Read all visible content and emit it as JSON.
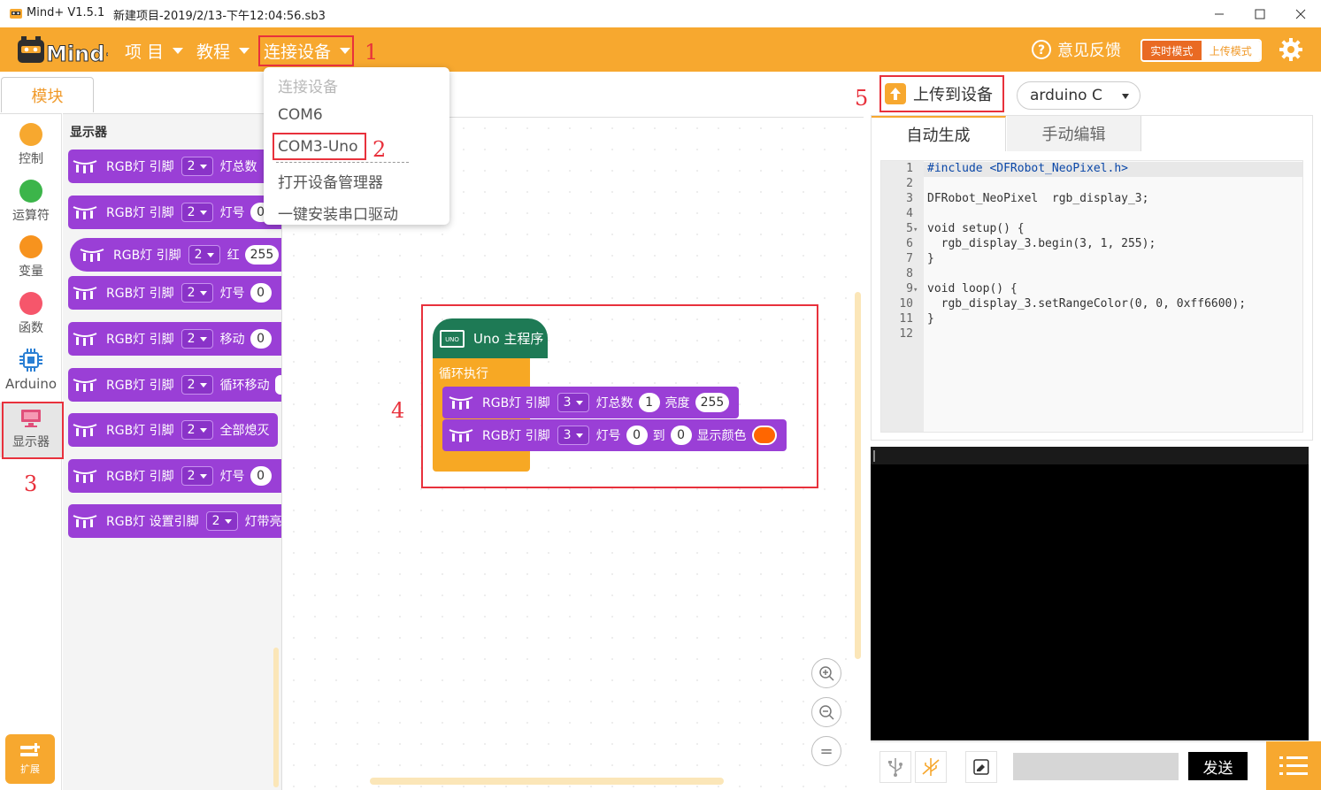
{
  "window": {
    "app_title": "Mind+ V1.5.1",
    "doc_title": "新建项目-2019/2/13-下午12:04:56.sb3"
  },
  "menubar": {
    "logo_text": "Mind+",
    "project": "项 目",
    "tutorial": "教程",
    "connect": "连接设备",
    "feedback": "意见反馈",
    "realtime_mode": "实时模式",
    "upload_mode": "上传模式"
  },
  "connect_menu": {
    "items": [
      {
        "label": "连接设备",
        "disabled": true
      },
      {
        "label": "COM6",
        "disabled": false
      },
      {
        "label": "COM3-Uno",
        "disabled": false
      },
      {
        "label": "打开设备管理器",
        "disabled": false
      },
      {
        "label": "一键安装串口驱动",
        "disabled": false
      }
    ]
  },
  "annotations": [
    "1",
    "2",
    "3",
    "4",
    "5"
  ],
  "left": {
    "modules_tab": "模块",
    "categories": [
      {
        "label": "控制",
        "color": "#f7a82f"
      },
      {
        "label": "运算符",
        "color": "#3cb54a"
      },
      {
        "label": "变量",
        "color": "#f7931e"
      },
      {
        "label": "函数",
        "color": "#f6566b"
      },
      {
        "label": "Arduino",
        "color": "#2a7fd4"
      },
      {
        "label": "显示器",
        "color": "#e04f7a"
      }
    ],
    "extension": "扩展"
  },
  "palette": {
    "title": "显示器",
    "blocks": [
      {
        "prefix": "RGB灯 引脚",
        "pin": "2",
        "rest": "灯总数",
        "value": ""
      },
      {
        "prefix": "RGB灯 引脚",
        "pin": "2",
        "rest": "灯号",
        "value": "0"
      },
      {
        "prefix": "RGB灯 引脚",
        "pin": "2",
        "rest": "红",
        "value": "255"
      },
      {
        "prefix": "RGB灯 引脚",
        "pin": "2",
        "rest": "灯号",
        "value": "0"
      },
      {
        "prefix": "RGB灯 引脚",
        "pin": "2",
        "rest": "移动",
        "value": "0"
      },
      {
        "prefix": "RGB灯 引脚",
        "pin": "2",
        "rest": "循环移动",
        "value": ""
      },
      {
        "prefix": "RGB灯 引脚",
        "pin": "2",
        "rest": "全部熄灭",
        "value": ""
      },
      {
        "prefix": "RGB灯 引脚",
        "pin": "2",
        "rest": "灯号",
        "value": "0"
      },
      {
        "prefix": "RGB灯 设置引脚",
        "pin": "2",
        "rest": "灯带亮",
        "value": ""
      }
    ]
  },
  "script": {
    "hat_label": "Uno 主程序",
    "board_chip": "UNO",
    "loop_label": "循环执行",
    "block1": {
      "prefix": "RGB灯 引脚",
      "pin": "3",
      "label1": "灯总数",
      "v1": "1",
      "label2": "亮度",
      "v2": "255"
    },
    "block2": {
      "prefix": "RGB灯 引脚",
      "pin": "3",
      "label1": "灯号",
      "v1": "0",
      "label2": "到",
      "v2": "0",
      "label3": "显示颜色",
      "color": "#ff6600"
    }
  },
  "zoom": {
    "zoom_in": "+",
    "zoom_out": "−",
    "reset": "="
  },
  "right": {
    "upload_button": "上传到设备",
    "board_select": "arduino C",
    "tab_auto": "自动生成",
    "tab_manual": "手动编辑",
    "code_lines": [
      "#include <DFRobot_NeoPixel.h>",
      "",
      "DFRobot_NeoPixel  rgb_display_3;",
      "",
      "void setup() {",
      "  rgb_display_3.begin(3, 1, 255);",
      "}",
      "",
      "void loop() {",
      "  rgb_display_3.setRangeColor(0, 0, 0xff6600);",
      "}",
      ""
    ],
    "send_button": "发送"
  }
}
